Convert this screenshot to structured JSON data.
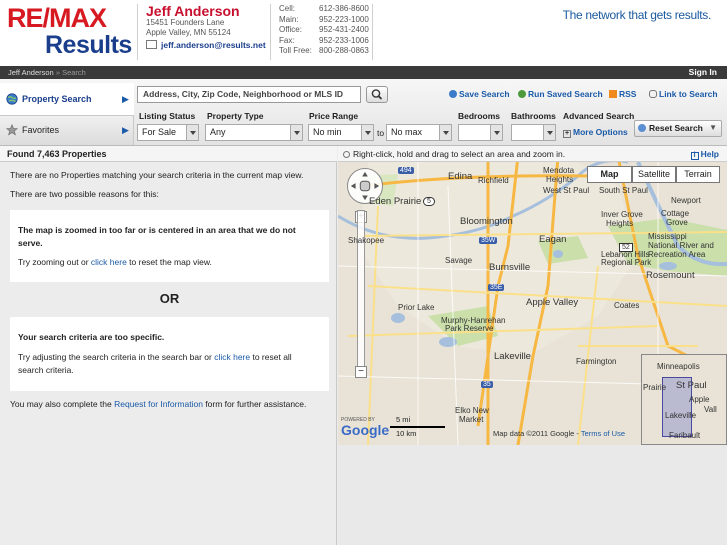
{
  "header": {
    "logo_top": "RE/MAX",
    "logo_bottom": "Results",
    "agent_name": "Jeff Anderson",
    "address_line1": "15451 Founders Lane",
    "address_line2": "Apple Valley, MN  55124",
    "email": "jeff.anderson@results.net",
    "contacts": [
      {
        "label": "Cell:",
        "value": "612-386-8600"
      },
      {
        "label": "Main:",
        "value": "952-223-1000"
      },
      {
        "label": "Office:",
        "value": "952-431-2400"
      },
      {
        "label": "Fax:",
        "value": "952-233-1006"
      },
      {
        "label": "Toll Free:",
        "value": "800-288-0863"
      }
    ],
    "tagline": "The network that gets results."
  },
  "nav": {
    "crumb_home": "Jeff Anderson",
    "crumb_sep": " » ",
    "crumb_current": "Search",
    "sign_in": "Sign In"
  },
  "search": {
    "tab_property": "Property Search",
    "tab_favorites": "Favorites",
    "query_placeholder": "Address, City, Zip Code, Neighborhood or MLS ID",
    "links": {
      "save": "Save Search",
      "run_saved": "Run Saved Search",
      "rss": "RSS",
      "link_to": "Link to Search"
    },
    "filters": {
      "listing_status_label": "Listing Status",
      "listing_status_value": "For Sale",
      "property_type_label": "Property Type",
      "property_type_value": "Any",
      "price_range_label": "Price Range",
      "price_min": "No min",
      "price_to": "to",
      "price_max": "No max",
      "bedrooms_label": "Bedrooms",
      "bathrooms_label": "Bathrooms",
      "advanced_label": "Advanced Search",
      "more_options": "More Options",
      "reset": "Reset Search"
    }
  },
  "results": {
    "found": "Found 7,463 Properties",
    "no_match": "There are no Properties matching your search criteria in the current map view.",
    "reasons_intro": "There are two possible reasons for this:",
    "reason1_title": "The map is zoomed in too far or is centered in an area that we do not serve.",
    "reason1_pre": "Try zooming out or ",
    "reason1_link": "click here",
    "reason1_post": " to reset the map view.",
    "or": "OR",
    "reason2_title": "Your search criteria are too specific.",
    "reason2_pre": "Try adjusting the search criteria in the search bar or ",
    "reason2_link": "click here",
    "reason2_post": " to reset all search criteria.",
    "footer_pre": "You may also complete the ",
    "footer_link": "Request for Information",
    "footer_post": " form for further assistance."
  },
  "map": {
    "hint": "Right-click, hold and drag to select an area and zoom in.",
    "help": "Help",
    "type_map": "Map",
    "type_satellite": "Satellite",
    "type_terrain": "Terrain",
    "places": {
      "edina": "Edina",
      "richfield": "Richfield",
      "mendota": "Mendota",
      "heights": "Heights",
      "west_st_paul": "West St Paul",
      "south_st_paul": "South St Paul",
      "eden_prairie": "Eden Prairie",
      "shakopee": "Shakopee",
      "bloomington": "Bloomington",
      "eagan": "Eagan",
      "inver_grove": "Inver Grove",
      "heights2": "Heights",
      "newport": "Newport",
      "cottage": "Cottage",
      "grove": "Grove",
      "savage": "Savage",
      "burnsville": "Burnsville",
      "rosemount": "Rosemount",
      "prior_lake": "Prior Lake",
      "apple_valley": "Apple Valley",
      "coates": "Coates",
      "murphy1": "Murphy-Hanrehan",
      "murphy2": "Park Reserve",
      "lakeville": "Lakeville",
      "farmington": "Farmington",
      "elko1": "Elko New",
      "elko2": "Market",
      "mississippi1": "Mississippi",
      "mississippi2": "National River and",
      "mississippi3": "Recreation Area",
      "lebanon1": "Lebanon Hills",
      "lebanon2": "Regional Park",
      "ov_minneapolis": "Minneapolis",
      "ov_stpaul": "St Paul",
      "ov_prairie": "Prairie",
      "ov_apple": "Apple",
      "ov_vall": "Vall",
      "ov_lakeville": "Lakeville",
      "ov_faribault": "Faribault"
    },
    "shields": {
      "i494": "494",
      "r5": "5",
      "i35w": "35W",
      "i35e": "35E",
      "r52": "52",
      "i35": "35"
    },
    "scale_mi": "5 mi",
    "scale_km": "10 km",
    "powered_by": "POWERED BY",
    "google": "Google",
    "credit": "Map data ©2011 Google - ",
    "terms": "Terms of Use"
  },
  "colors": {
    "remax_red": "#d71921",
    "remax_blue": "#1a3e8c",
    "link_blue": "#1a5aa8",
    "map_bg": "#e8e3d6",
    "water": "#a5bfdd",
    "park": "#cadfaa",
    "road_orange": "#f7b843"
  }
}
